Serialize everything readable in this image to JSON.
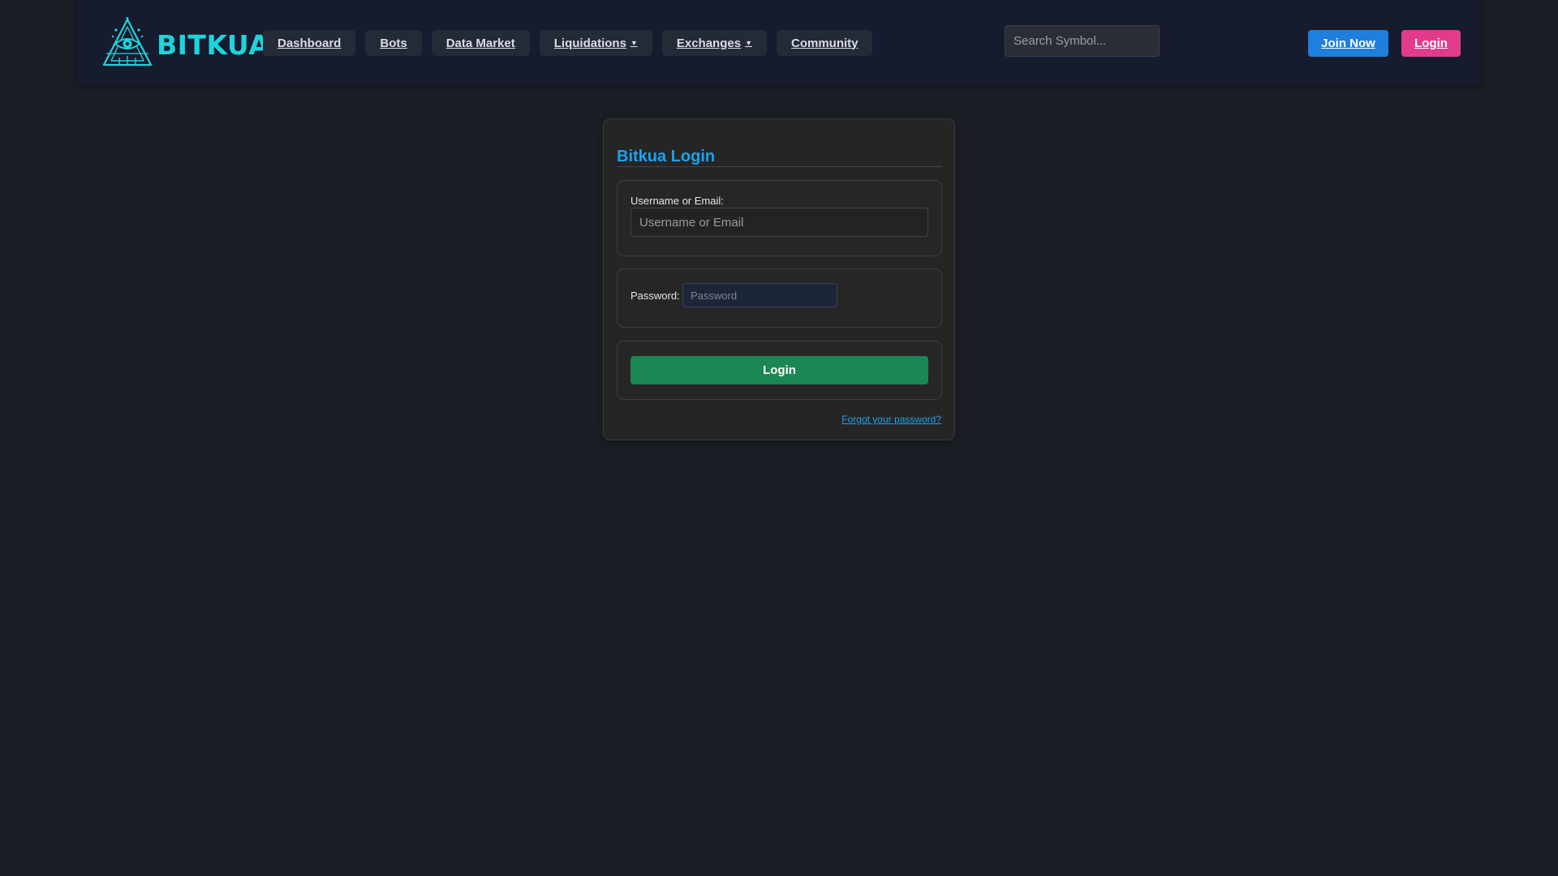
{
  "header": {
    "logo_text": "BITKUA",
    "logo_icon": "eye-pyramid-icon",
    "nav": [
      {
        "label": "Dashboard"
      },
      {
        "label": "Bots"
      },
      {
        "label": "Data Market"
      },
      {
        "label": "Liquidations",
        "caret": "▼"
      },
      {
        "label": "Exchanges",
        "caret": "▼"
      },
      {
        "label": "Community"
      }
    ],
    "search": {
      "placeholder": "Search Symbol...",
      "value": ""
    },
    "join_label": "Join Now",
    "login_label": "Login"
  },
  "login": {
    "title": "Bitkua Login",
    "username_label": "Username or Email:",
    "username_placeholder": "Username or Email",
    "username_value": "",
    "password_label": "Password:",
    "password_placeholder": "Password",
    "password_value": "",
    "submit_label": "Login",
    "forgot_label": "Forgot your password?"
  },
  "colors": {
    "background": "#1b1e24",
    "header": "#161b2d",
    "brand_cyan": "#1fd3dc",
    "accent_blue": "#1e7fdc",
    "accent_pink": "#e23b8c",
    "title_blue": "#1aa3f0",
    "login_green": "#1b8754"
  }
}
